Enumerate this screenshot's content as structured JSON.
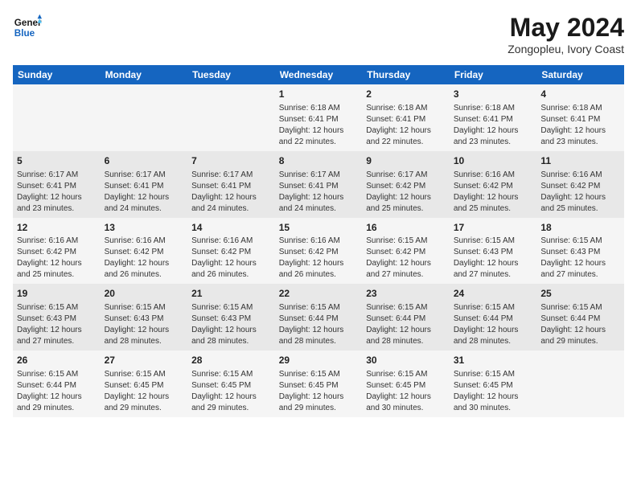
{
  "header": {
    "logo_line1": "General",
    "logo_line2": "Blue",
    "month_year": "May 2024",
    "location": "Zongopleu, Ivory Coast"
  },
  "weekdays": [
    "Sunday",
    "Monday",
    "Tuesday",
    "Wednesday",
    "Thursday",
    "Friday",
    "Saturday"
  ],
  "weeks": [
    [
      {
        "day": "",
        "info": ""
      },
      {
        "day": "",
        "info": ""
      },
      {
        "day": "",
        "info": ""
      },
      {
        "day": "1",
        "info": "Sunrise: 6:18 AM\nSunset: 6:41 PM\nDaylight: 12 hours\nand 22 minutes."
      },
      {
        "day": "2",
        "info": "Sunrise: 6:18 AM\nSunset: 6:41 PM\nDaylight: 12 hours\nand 22 minutes."
      },
      {
        "day": "3",
        "info": "Sunrise: 6:18 AM\nSunset: 6:41 PM\nDaylight: 12 hours\nand 23 minutes."
      },
      {
        "day": "4",
        "info": "Sunrise: 6:18 AM\nSunset: 6:41 PM\nDaylight: 12 hours\nand 23 minutes."
      }
    ],
    [
      {
        "day": "5",
        "info": "Sunrise: 6:17 AM\nSunset: 6:41 PM\nDaylight: 12 hours\nand 23 minutes."
      },
      {
        "day": "6",
        "info": "Sunrise: 6:17 AM\nSunset: 6:41 PM\nDaylight: 12 hours\nand 24 minutes."
      },
      {
        "day": "7",
        "info": "Sunrise: 6:17 AM\nSunset: 6:41 PM\nDaylight: 12 hours\nand 24 minutes."
      },
      {
        "day": "8",
        "info": "Sunrise: 6:17 AM\nSunset: 6:41 PM\nDaylight: 12 hours\nand 24 minutes."
      },
      {
        "day": "9",
        "info": "Sunrise: 6:17 AM\nSunset: 6:42 PM\nDaylight: 12 hours\nand 25 minutes."
      },
      {
        "day": "10",
        "info": "Sunrise: 6:16 AM\nSunset: 6:42 PM\nDaylight: 12 hours\nand 25 minutes."
      },
      {
        "day": "11",
        "info": "Sunrise: 6:16 AM\nSunset: 6:42 PM\nDaylight: 12 hours\nand 25 minutes."
      }
    ],
    [
      {
        "day": "12",
        "info": "Sunrise: 6:16 AM\nSunset: 6:42 PM\nDaylight: 12 hours\nand 25 minutes."
      },
      {
        "day": "13",
        "info": "Sunrise: 6:16 AM\nSunset: 6:42 PM\nDaylight: 12 hours\nand 26 minutes."
      },
      {
        "day": "14",
        "info": "Sunrise: 6:16 AM\nSunset: 6:42 PM\nDaylight: 12 hours\nand 26 minutes."
      },
      {
        "day": "15",
        "info": "Sunrise: 6:16 AM\nSunset: 6:42 PM\nDaylight: 12 hours\nand 26 minutes."
      },
      {
        "day": "16",
        "info": "Sunrise: 6:15 AM\nSunset: 6:42 PM\nDaylight: 12 hours\nand 27 minutes."
      },
      {
        "day": "17",
        "info": "Sunrise: 6:15 AM\nSunset: 6:43 PM\nDaylight: 12 hours\nand 27 minutes."
      },
      {
        "day": "18",
        "info": "Sunrise: 6:15 AM\nSunset: 6:43 PM\nDaylight: 12 hours\nand 27 minutes."
      }
    ],
    [
      {
        "day": "19",
        "info": "Sunrise: 6:15 AM\nSunset: 6:43 PM\nDaylight: 12 hours\nand 27 minutes."
      },
      {
        "day": "20",
        "info": "Sunrise: 6:15 AM\nSunset: 6:43 PM\nDaylight: 12 hours\nand 28 minutes."
      },
      {
        "day": "21",
        "info": "Sunrise: 6:15 AM\nSunset: 6:43 PM\nDaylight: 12 hours\nand 28 minutes."
      },
      {
        "day": "22",
        "info": "Sunrise: 6:15 AM\nSunset: 6:44 PM\nDaylight: 12 hours\nand 28 minutes."
      },
      {
        "day": "23",
        "info": "Sunrise: 6:15 AM\nSunset: 6:44 PM\nDaylight: 12 hours\nand 28 minutes."
      },
      {
        "day": "24",
        "info": "Sunrise: 6:15 AM\nSunset: 6:44 PM\nDaylight: 12 hours\nand 28 minutes."
      },
      {
        "day": "25",
        "info": "Sunrise: 6:15 AM\nSunset: 6:44 PM\nDaylight: 12 hours\nand 29 minutes."
      }
    ],
    [
      {
        "day": "26",
        "info": "Sunrise: 6:15 AM\nSunset: 6:44 PM\nDaylight: 12 hours\nand 29 minutes."
      },
      {
        "day": "27",
        "info": "Sunrise: 6:15 AM\nSunset: 6:45 PM\nDaylight: 12 hours\nand 29 minutes."
      },
      {
        "day": "28",
        "info": "Sunrise: 6:15 AM\nSunset: 6:45 PM\nDaylight: 12 hours\nand 29 minutes."
      },
      {
        "day": "29",
        "info": "Sunrise: 6:15 AM\nSunset: 6:45 PM\nDaylight: 12 hours\nand 29 minutes."
      },
      {
        "day": "30",
        "info": "Sunrise: 6:15 AM\nSunset: 6:45 PM\nDaylight: 12 hours\nand 30 minutes."
      },
      {
        "day": "31",
        "info": "Sunrise: 6:15 AM\nSunset: 6:45 PM\nDaylight: 12 hours\nand 30 minutes."
      },
      {
        "day": "",
        "info": ""
      }
    ]
  ]
}
